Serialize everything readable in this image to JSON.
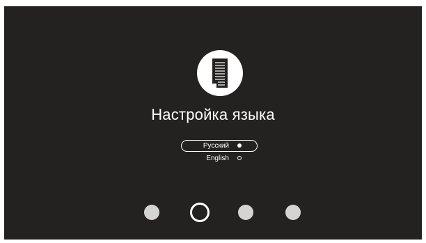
{
  "colors": {
    "background": "#242121",
    "foreground": "#ffffff",
    "dot": "#d4d4d4"
  },
  "header": {
    "icon": "document-icon",
    "title": "Настройка языка"
  },
  "languages": [
    {
      "label": "Русский",
      "selected": true
    },
    {
      "label": "English",
      "selected": false
    }
  ],
  "pager": {
    "total_pages": 4,
    "current_page": 2
  }
}
